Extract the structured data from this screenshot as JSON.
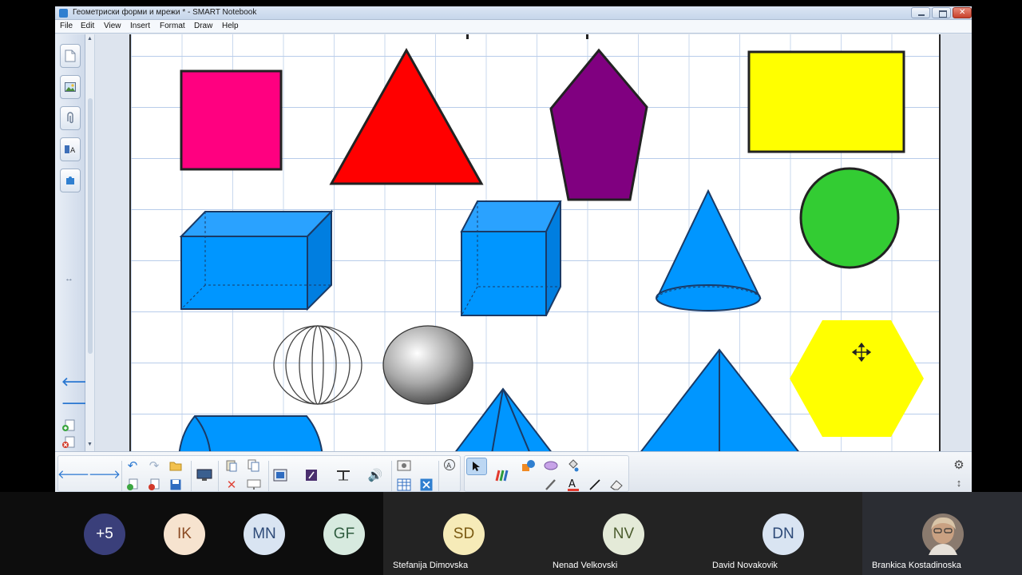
{
  "window": {
    "title": "Геометриски форми и мрежи * - SMART Notebook"
  },
  "menu": [
    "File",
    "Edit",
    "View",
    "Insert",
    "Format",
    "Draw",
    "Help"
  ],
  "sidebar": {
    "tabs": [
      "page-sorter",
      "gallery",
      "attachments",
      "properties",
      "add-ons"
    ]
  },
  "canvas": {
    "shapes": [
      {
        "name": "square",
        "color": "#ff0080"
      },
      {
        "name": "triangle",
        "color": "#ff0000"
      },
      {
        "name": "pentagon",
        "color": "#800080"
      },
      {
        "name": "rectangle",
        "color": "#ffff00"
      },
      {
        "name": "circle",
        "color": "#33cc33"
      },
      {
        "name": "rectangular-prism",
        "color": "#0096ff"
      },
      {
        "name": "cube",
        "color": "#0096ff"
      },
      {
        "name": "cone",
        "color": "#0096ff"
      },
      {
        "name": "wireframe-sphere",
        "color": "#555555"
      },
      {
        "name": "shaded-sphere",
        "color": "#888888"
      },
      {
        "name": "hexagon",
        "color": "#ffff00"
      },
      {
        "name": "cylinder",
        "color": "#0096ff"
      },
      {
        "name": "pyramid",
        "color": "#0096ff"
      }
    ]
  },
  "participants": [
    {
      "initials": "+5",
      "name": "",
      "bg": "#3a3f7a",
      "fg": "#ffffff"
    },
    {
      "initials": "IK",
      "name": "",
      "bg": "#f6e3cf",
      "fg": "#8a4a22"
    },
    {
      "initials": "MN",
      "name": "",
      "bg": "#d9e4f2",
      "fg": "#2d4a78"
    },
    {
      "initials": "GF",
      "name": "",
      "bg": "#d7eadf",
      "fg": "#2f5c3f"
    },
    {
      "initials": "SD",
      "name": "Stefanija Dimovska",
      "bg": "#f6ebb8",
      "fg": "#7a5a12"
    },
    {
      "initials": "NV",
      "name": "Nenad Velkovski",
      "bg": "#e4ead8",
      "fg": "#4b5c2e"
    },
    {
      "initials": "DN",
      "name": "David Novakovik",
      "bg": "#d9e4f2",
      "fg": "#2d4a78"
    },
    {
      "initials": "",
      "name": "Brankica Kostadinoska",
      "bg": "#c9a58a",
      "fg": "#ffffff"
    }
  ]
}
